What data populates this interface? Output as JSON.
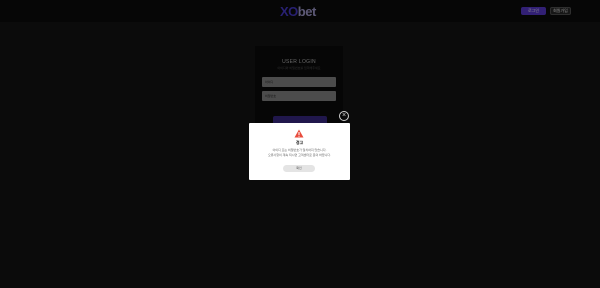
{
  "header": {
    "logo_part1": "XO",
    "logo_part2": "bet",
    "login_button": "로그인",
    "join_button": "회원가입"
  },
  "login_form": {
    "title": "USER LOGIN",
    "subtitle": "아이디와 비밀번호를 입력해주세요",
    "id_placeholder": "아이디",
    "pw_placeholder": "비밀번호",
    "submit_label": "로그인"
  },
  "alert": {
    "title": "경고",
    "message_line1": "아이디 또는 비밀번호가 일치하지 않습니다.",
    "message_line2": "오류사항이 계속 되시면 고객센터로 문의 바랍니다.",
    "ok_button": "확인"
  },
  "close_icon_glyph": "×"
}
